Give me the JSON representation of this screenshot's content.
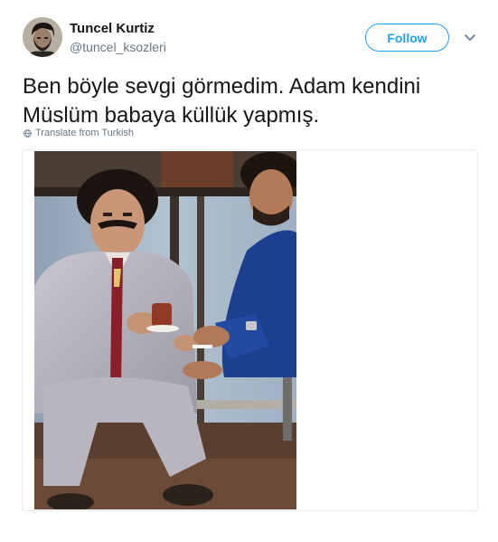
{
  "author": {
    "display_name": "Tuncel Kurtiz",
    "handle": "@tuncel_ksozleri",
    "avatar_icon": "avatar-portrait"
  },
  "actions": {
    "follow_label": "Follow",
    "menu_icon": "chevron-down-icon"
  },
  "tweet": {
    "text": "Ben böyle sevgi görmedim. Adam kendini\nMüslüm babaya küllük yapmış.",
    "translate_label": "Translate from Turkish"
  },
  "media": {
    "type": "photo",
    "description_icon": "vintage-photo"
  },
  "colors": {
    "accent": "#1da1f2",
    "text_primary": "#14171a",
    "text_secondary": "#657786",
    "border": "#e6ecf0"
  }
}
